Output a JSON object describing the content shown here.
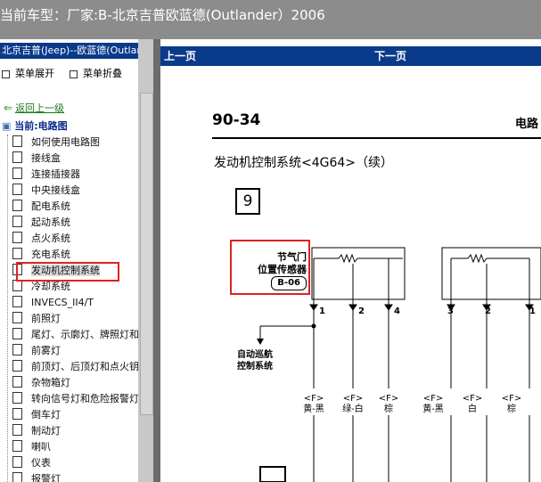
{
  "header": {
    "title": "当前车型：厂家:B-北京吉普欧蓝德(Outlander）2006"
  },
  "sidebar": {
    "header": "北京吉普(Jeep)--欧蓝德(Outlander)",
    "expand_label": "菜单展开",
    "collapse_label": "菜单折叠",
    "back_label": "返回上一级",
    "current_label": "当前:电路图",
    "items": [
      {
        "label": "如何使用电路图"
      },
      {
        "label": "接线盒"
      },
      {
        "label": "连接插接器"
      },
      {
        "label": "中央接线盒"
      },
      {
        "label": "配电系统"
      },
      {
        "label": "起动系统"
      },
      {
        "label": "点火系统"
      },
      {
        "label": "充电系统"
      },
      {
        "label": "发动机控制系统"
      },
      {
        "label": "冷却系统"
      },
      {
        "label": "INVECS_II4/T"
      },
      {
        "label": "前照灯"
      },
      {
        "label": "尾灯、示廓灯、牌照灯和"
      },
      {
        "label": "前雾灯"
      },
      {
        "label": "前顶灯、后顶灯和点火钥"
      },
      {
        "label": "杂物箱灯"
      },
      {
        "label": "转向信号灯和危险报警灯"
      },
      {
        "label": "倒车灯"
      },
      {
        "label": "制动灯"
      },
      {
        "label": "喇叭"
      },
      {
        "label": "仪表"
      },
      {
        "label": "报警灯"
      }
    ]
  },
  "nav": {
    "prev_label": "上一页",
    "next_label": "下一页"
  },
  "document": {
    "page_number": "90-34",
    "section": "电路",
    "heading": "发动机控制系统<4G64>（续）",
    "box_number": "9",
    "component_line1": "节气门",
    "component_line2": "位置传感器",
    "component_code": "B-06",
    "pins_left": [
      "1",
      "2",
      "4"
    ],
    "pins_right": [
      "3",
      "2",
      "1"
    ],
    "cruise_line1": "自动巡航",
    "cruise_line2": "控制系统",
    "wires": [
      {
        "code": "<F>",
        "color": "黄-黑"
      },
      {
        "code": "<F>",
        "color": "绿-白"
      },
      {
        "code": "<F>",
        "color": "棕"
      },
      {
        "code": "<F>",
        "color": "黄-黑"
      },
      {
        "code": "<F>",
        "color": "白"
      },
      {
        "code": "<F>",
        "color": "棕"
      }
    ]
  },
  "colors": {
    "topbar": "#8c8c8c",
    "nav_blue": "#0a3a8a",
    "highlight_red": "#e02020"
  },
  "icons": [
    "back-arrow-icon",
    "document-icon",
    "expand-icon",
    "collapse-icon"
  ]
}
